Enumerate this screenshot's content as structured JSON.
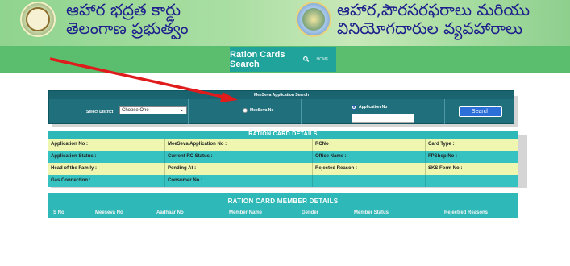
{
  "header": {
    "left_title_line1": "ఆహార భద్రత కార్డు",
    "left_title_line2": "తెలంగాణ ప్రభుత్వం",
    "right_title_line1": "ఆహార,పౌరసరఫరాలు మరియు",
    "right_title_line2": "వినియోగదారుల వ్యవహారాలు",
    "left_emblem": "telangana-emblem-icon",
    "right_emblem": "civil-supplies-emblem-icon"
  },
  "nav": {
    "search_label": "Ration Cards Search",
    "search_icon": "search-icon",
    "home_label": "HOME"
  },
  "search_form": {
    "title": "MeeSeva Application Search",
    "district_label": "Select District",
    "district_value": "Choose One",
    "radio_meeseva_label": "MeeSeva No",
    "radio_application_label": "Application No",
    "selected_radio": "Application No",
    "application_input_value": "",
    "search_button": "Search"
  },
  "details": {
    "title": "RATION CARD DETAILS",
    "rows": [
      [
        "Application No :",
        "MeeSeva Application No :",
        "RCNo :",
        "Card Type :"
      ],
      [
        "Application Status :",
        "Current RC Status :",
        "Office Name :",
        "FPShop No :"
      ],
      [
        "Head of the Family :",
        "Pending At :",
        "Rejected Reason :",
        "SKS Form No :"
      ],
      [
        "Gas Connection :",
        "Consumer No :",
        "",
        ""
      ]
    ]
  },
  "members": {
    "title": "RATION CARD MEMBER DETAILS",
    "columns": [
      "S No",
      "Meeseva No",
      "Aadhaar No",
      "Member Name",
      "Gender",
      "Member Status",
      "Rejectred Reasons"
    ]
  },
  "colors": {
    "header_green": "#a9dea2",
    "nav_green": "#5bbd6e",
    "nav_button": "#1fa39a",
    "panel_teal": "#1f6f7c",
    "table_teal": "#2fb8b8",
    "row_yellow": "#eef6b0",
    "search_blue": "#2d6fd8",
    "arrow_red": "#e01b1b",
    "telugu_text": "#1e1f8c"
  }
}
